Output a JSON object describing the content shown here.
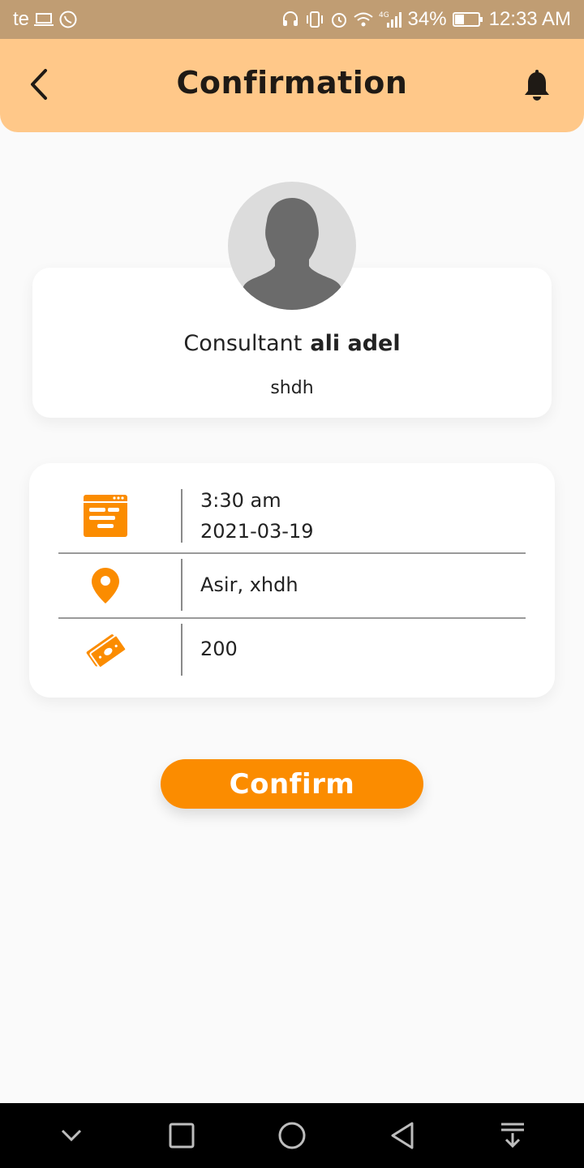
{
  "status_bar": {
    "carrier": "te",
    "battery_percent": "34%",
    "time": "12:33 AM",
    "network": "4G",
    "color": "#c09d73"
  },
  "header": {
    "title": "Confirmation",
    "background": "#ffc889"
  },
  "profile": {
    "label": "Consultant",
    "name": "ali adel",
    "specialty": "shdh"
  },
  "details": {
    "time": "3:30 am",
    "date": "2021-03-19",
    "location": "Asir, xhdh",
    "price": "200",
    "icon_color": "#fb8c00"
  },
  "actions": {
    "confirm_label": "Confirm",
    "accent": "#fb8c00"
  },
  "icons": {
    "back": "chevron-left-icon",
    "bell": "bell-icon",
    "calendar": "schedule-icon",
    "location": "location-pin-icon",
    "money": "money-icon"
  }
}
